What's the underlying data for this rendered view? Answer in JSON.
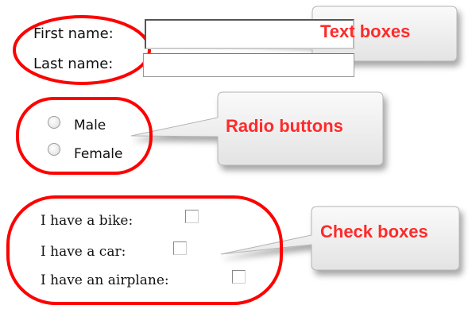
{
  "form": {
    "first_name_label": "First name:",
    "last_name_label": "Last name:",
    "radio_male": "Male",
    "radio_female": "Female",
    "bike_label": "I have a bike:",
    "car_label": "I have a car:",
    "airplane_label": "I have an airplane:"
  },
  "callouts": {
    "text_boxes": "Text boxes",
    "radio_buttons": "Radio buttons",
    "check_boxes": "Check boxes"
  },
  "colors": {
    "highlight_ring": "#ff0000",
    "callout_text": "#ff2a2a",
    "callout_fill": "#f2f2f2"
  }
}
